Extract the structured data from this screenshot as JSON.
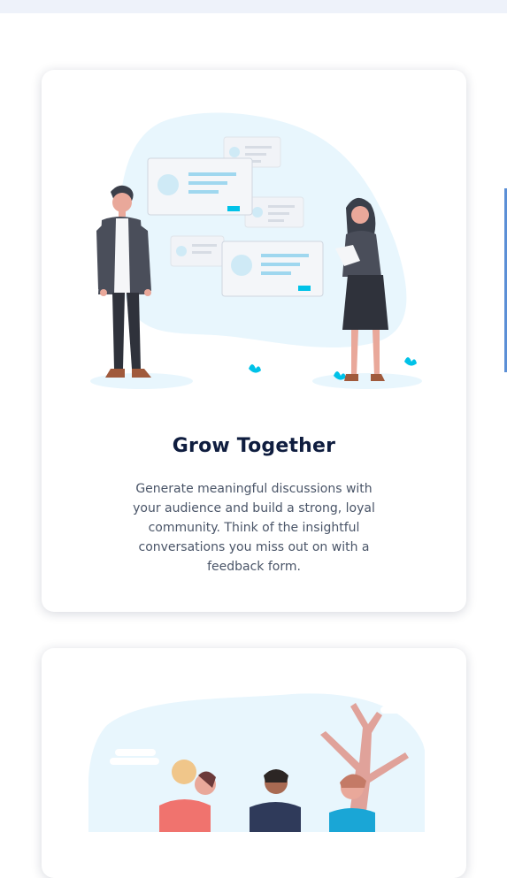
{
  "features": [
    {
      "illustration": "two-people-discussion-illustration",
      "title": "Grow Together",
      "description": "Generate meaningful discussions with your audience and build a strong, loyal community. Think of the insightful conversations you miss out on with a feedback form."
    },
    {
      "illustration": "people-under-tree-illustration"
    }
  ],
  "colors": {
    "title": "#0f1d3f",
    "body_text": "#4a5568",
    "accent": "#00c2e8",
    "blob": "#e8f6fd",
    "top_band": "#eef2fa"
  }
}
